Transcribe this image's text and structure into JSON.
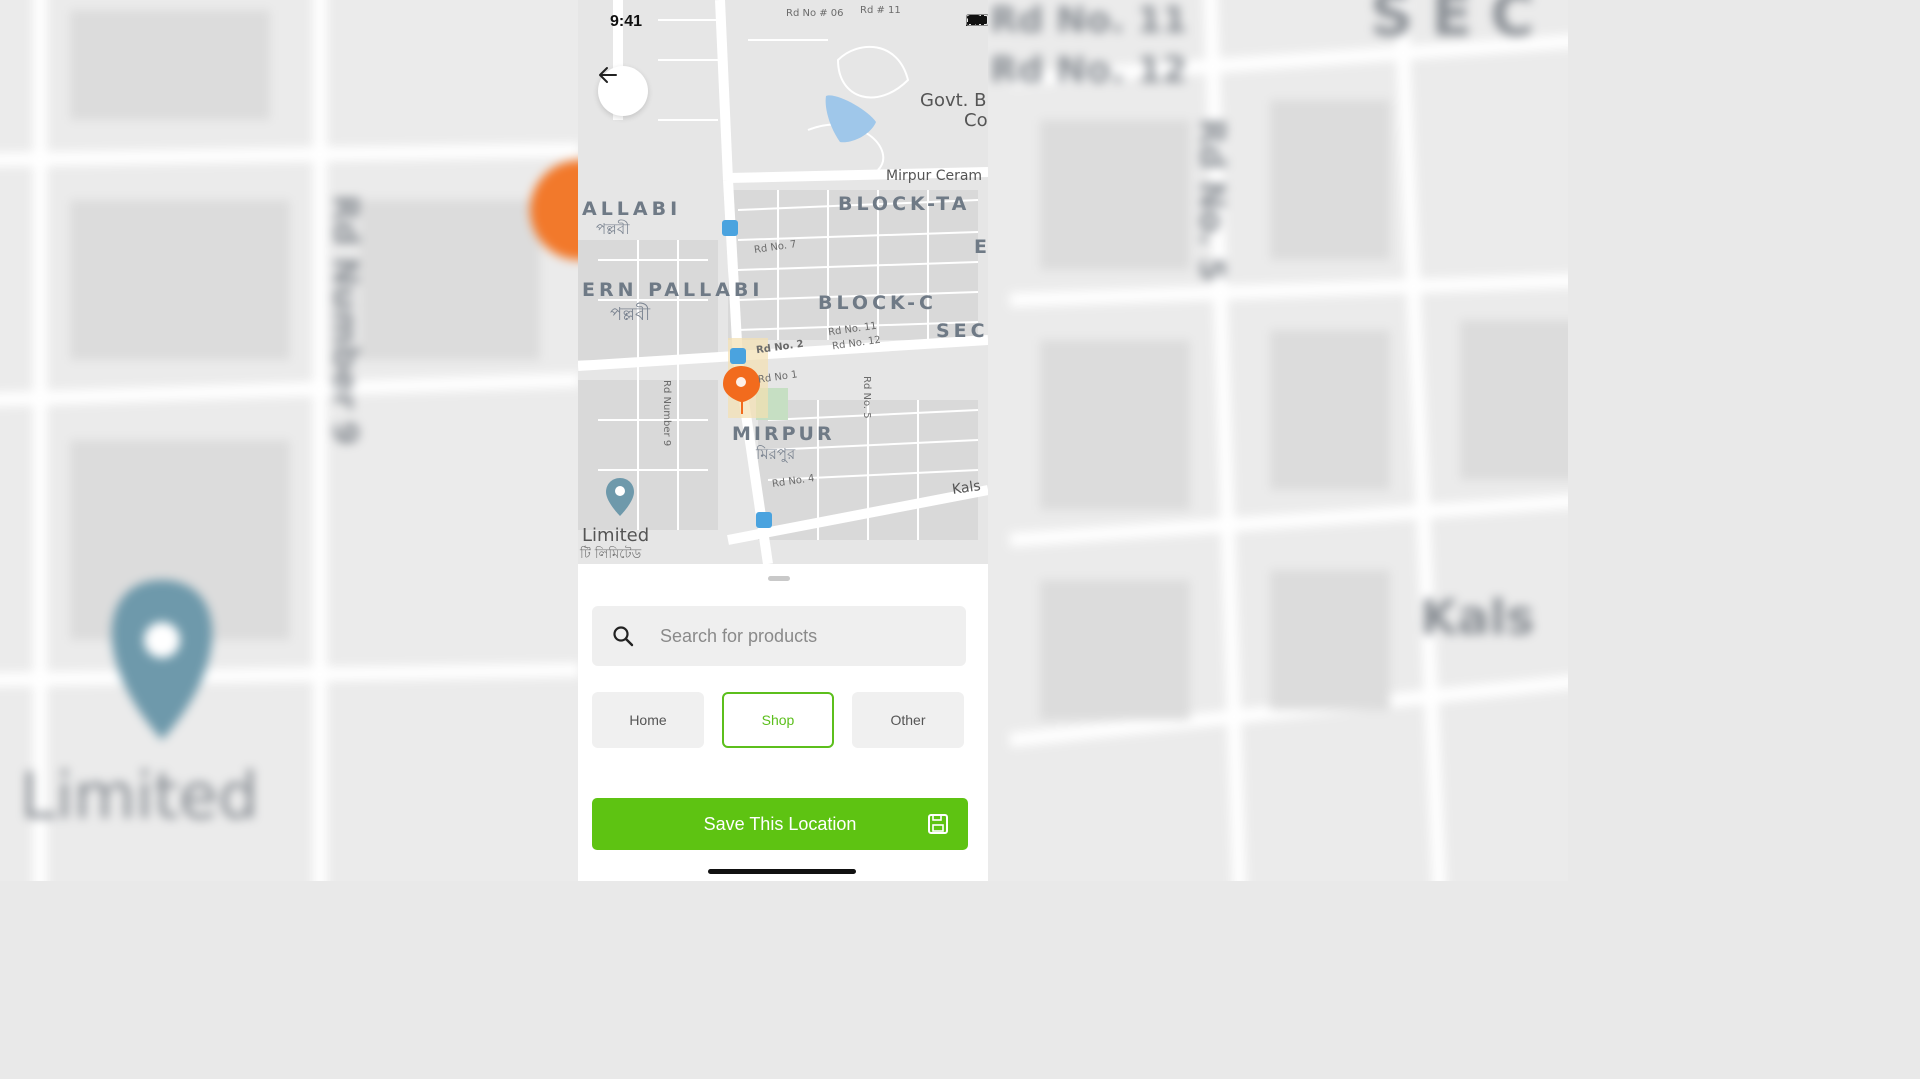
{
  "status_bar": {
    "time": "9:41"
  },
  "map": {
    "labels": {
      "pallabi": "ALLABI",
      "pallabi_bn": "পল্লবী",
      "eastern_pallabi": "ERN PALLABI",
      "eastern_pallabi_bn": "পল্লবী",
      "block_ta": "BLOCK-TA",
      "block_c": "BLOCK-C",
      "sec": "SEC",
      "mirpur": "MIRPUR",
      "mirpur_bn": "মিরপুর",
      "mirpur_ceram": "Mirpur Ceram",
      "govt": "Govt. B",
      "govt2": "Co",
      "limited": "Limited",
      "limited_bn": "টি লিমিটেড",
      "kals": "Kals",
      "rd_no_7": "Rd No. 7",
      "rd_no_2": "Rd No. 2",
      "rd_no_1": "Rd No 1",
      "rd_no_11": "Rd No. 11",
      "rd_no_12": "Rd No. 12",
      "rd_no_4": "Rd No. 4",
      "rd_no_5": "Rd No. 5",
      "rd_number_9": "Rd Number 9",
      "rd_no_06": "Rd No # 06",
      "rd_11": "Rd # 11",
      "e": "E"
    }
  },
  "background": {
    "sec": "SEC",
    "rd_no_11": "Rd No. 11",
    "rd_no_12": "Rd No. 12",
    "rd_no_5": "Rd No. 5",
    "rd_number_9": "Rd Number 9",
    "limited": "Limited",
    "kals": "Kals"
  },
  "search": {
    "placeholder": "Search for products"
  },
  "location_types": [
    {
      "label": "Home",
      "active": false
    },
    {
      "label": "Shop",
      "active": true
    },
    {
      "label": "Other",
      "active": false
    }
  ],
  "save_button": {
    "label": "Save This Location"
  },
  "colors": {
    "accent": "#5ec312",
    "pin": "#f26b1d",
    "map_bg": "#e6e6e6"
  }
}
